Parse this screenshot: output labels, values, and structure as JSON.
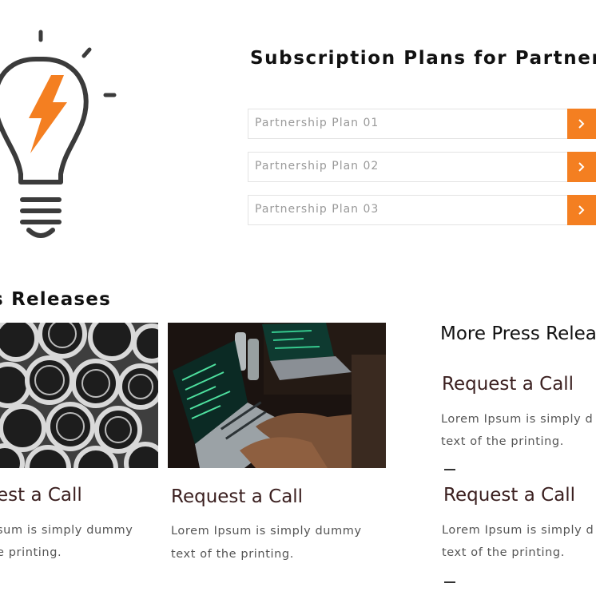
{
  "plans": {
    "title": "Subscription Plans for Partners",
    "items": [
      {
        "label": "Partnership Plan 01"
      },
      {
        "label": "Partnership Plan 02"
      },
      {
        "label": "Partnership Plan 03"
      }
    ]
  },
  "press": {
    "title": "s Releases",
    "cards": [
      {
        "heading": "est a Call",
        "line1": "sum is simply dummy",
        "line2": "e printing."
      },
      {
        "heading": "Request a Call",
        "line1": "Lorem Ipsum is simply dummy",
        "line2": "text of the printing."
      }
    ]
  },
  "more": {
    "title": "More Press Relea",
    "items": [
      {
        "heading": "Request a Call",
        "line1": "Lorem Ipsum is simply d",
        "line2": "text of the printing."
      },
      {
        "heading": "Request a Call",
        "line1": "Lorem Ipsum is simply d",
        "line2": "text of the printing."
      }
    ]
  },
  "colors": {
    "accent": "#f47f21",
    "heading": "#3a1f1f"
  },
  "icons": [
    "lightbulb-icon",
    "lightning-bolt-icon",
    "chevron-right-icon"
  ]
}
